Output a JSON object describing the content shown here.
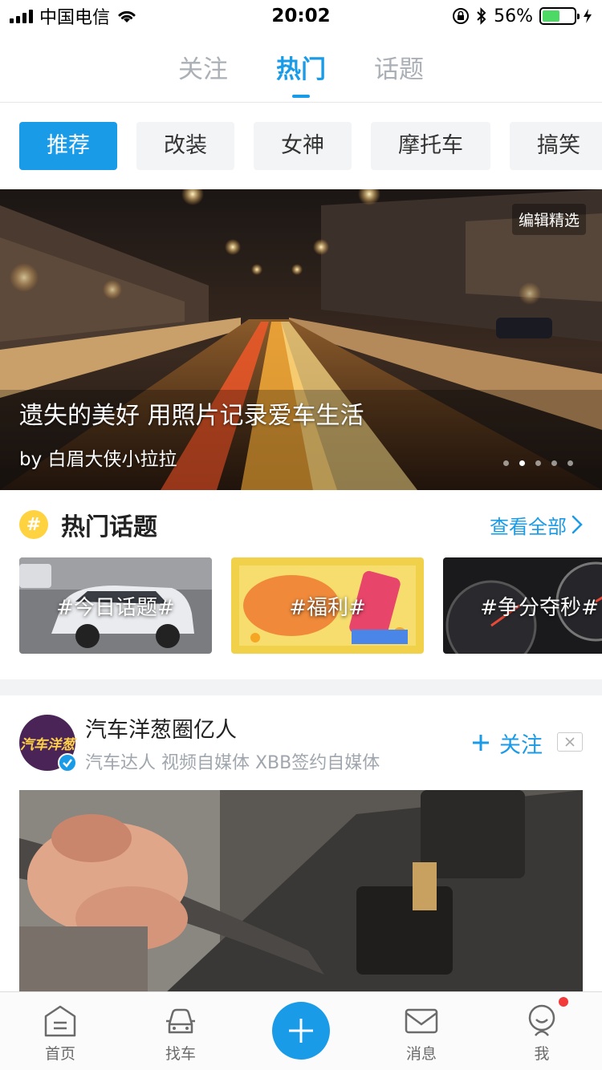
{
  "status_bar": {
    "carrier": "中国电信",
    "time": "20:02",
    "battery_percent": "56%",
    "battery_level": 0.56,
    "icons": [
      "signal-icon",
      "wifi-icon",
      "rotation-lock-icon",
      "bluetooth-icon",
      "battery-icon",
      "charging-icon"
    ]
  },
  "top_tabs": [
    {
      "label": "关注",
      "active": false
    },
    {
      "label": "热门",
      "active": true
    },
    {
      "label": "话题",
      "active": false
    }
  ],
  "chips": [
    {
      "label": "推荐",
      "active": true
    },
    {
      "label": "改装",
      "active": false
    },
    {
      "label": "女神",
      "active": false
    },
    {
      "label": "摩托车",
      "active": false
    },
    {
      "label": "搞笑",
      "active": false
    }
  ],
  "banner": {
    "badge": "编辑精选",
    "caption": "遗失的美好 用照片记录爱车生活",
    "author": "by 白眉大侠小拉拉",
    "dot_count": 5,
    "active_dot": 2
  },
  "hot_topics": {
    "badge": "#",
    "title": "热门话题",
    "view_all": "查看全部",
    "cards": [
      {
        "label": "#今日话题#"
      },
      {
        "label": "#福利#"
      },
      {
        "label": "#争分夺秒#"
      }
    ]
  },
  "feed": {
    "avatar_text": "汽车洋葱",
    "name": "汽车洋葱圈亿人",
    "subtitle": "汽车达人 视频自媒体 XBB签约自媒体",
    "follow_label": "关注"
  },
  "tabbar": {
    "home": "首页",
    "find_car": "找车",
    "messages": "消息",
    "me": "我"
  },
  "colors": {
    "accent": "#1a9be8",
    "chip_bg": "#f3f4f6",
    "hot_badge": "#ffd23f",
    "notify_dot": "#f23a3a"
  }
}
